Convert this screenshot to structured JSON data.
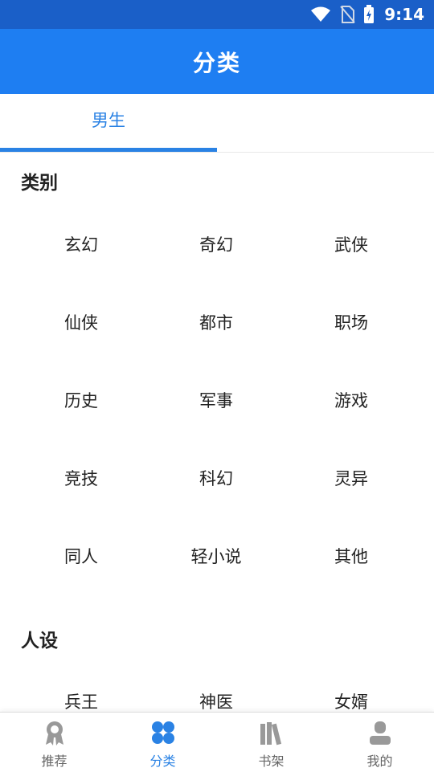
{
  "status_bar": {
    "time": "9:14"
  },
  "app_bar": {
    "title": "分类"
  },
  "tabs": [
    {
      "label": "男生"
    }
  ],
  "sections": [
    {
      "title": "类别",
      "items": [
        "玄幻",
        "奇幻",
        "武侠",
        "仙侠",
        "都市",
        "职场",
        "历史",
        "军事",
        "游戏",
        "竞技",
        "科幻",
        "灵异",
        "同人",
        "轻小说",
        "其他"
      ]
    },
    {
      "title": "人设",
      "items": [
        "兵王",
        "神医",
        "女婿"
      ]
    }
  ],
  "bottom_nav": [
    {
      "label": "推荐",
      "icon": "award-icon"
    },
    {
      "label": "分类",
      "icon": "category-icon"
    },
    {
      "label": "书架",
      "icon": "bookshelf-icon"
    },
    {
      "label": "我的",
      "icon": "profile-icon"
    }
  ],
  "colors": {
    "primary": "#1e7ef2",
    "status_bar": "#1a5fc8",
    "tab_active": "#2a82e4"
  }
}
